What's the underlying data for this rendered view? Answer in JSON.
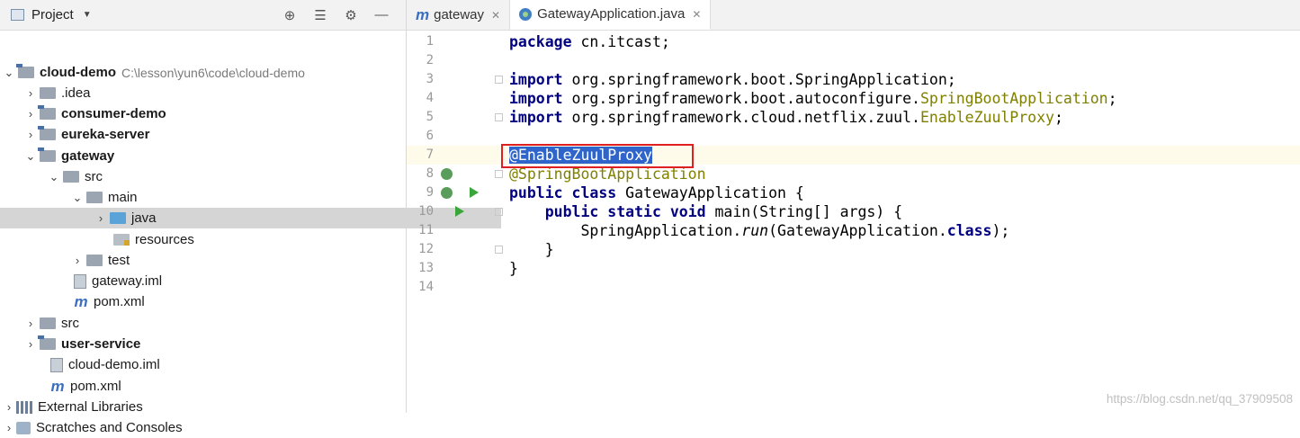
{
  "project_panel": {
    "title": "Project",
    "tools": [
      "target-icon",
      "collapse-icon",
      "gear-icon",
      "minimize-icon"
    ],
    "tree": [
      {
        "label": "cloud-demo",
        "path": "C:\\lesson\\yun6\\code\\cloud-demo"
      },
      {
        "label": ".idea"
      },
      {
        "label": "consumer-demo"
      },
      {
        "label": "eureka-server"
      },
      {
        "label": "gateway"
      },
      {
        "label": "src"
      },
      {
        "label": "main"
      },
      {
        "label": "java"
      },
      {
        "label": "resources"
      },
      {
        "label": "test"
      },
      {
        "label": "gateway.iml"
      },
      {
        "label": "pom.xml"
      },
      {
        "label": "src"
      },
      {
        "label": "user-service"
      },
      {
        "label": "cloud-demo.iml"
      },
      {
        "label": "pom.xml"
      },
      {
        "label": "External Libraries"
      },
      {
        "label": "Scratches and Consoles"
      }
    ]
  },
  "editor": {
    "tabs": [
      {
        "label": "gateway",
        "close": "✕"
      },
      {
        "label": "GatewayApplication.java",
        "close": "✕"
      }
    ],
    "line_numbers": [
      "1",
      "2",
      "3",
      "4",
      "5",
      "6",
      "7",
      "8",
      "9",
      "10",
      "11",
      "12",
      "13",
      "14"
    ],
    "code": {
      "l1_kw": "package",
      "l1_rest": " cn.itcast;",
      "l3_kw": "import",
      "l3_rest": " org.springframework.boot.SpringApplication;",
      "l4_kw": "import",
      "l4_rest": " org.springframework.boot.autoconfigure.",
      "l4_ann": "SpringBootApplication",
      "l4_end": ";",
      "l5_kw": "import",
      "l5_rest": " org.springframework.cloud.netflix.zuul.",
      "l5_ann": "EnableZuulProxy",
      "l5_end": ";",
      "l7_sel": "@EnableZuulProxy",
      "l8_ann": "@SpringBootApplication",
      "l9_kw": "public class",
      "l9_rest": " GatewayApplication {",
      "l10_indent": "    ",
      "l10_kw": "public static void",
      "l10_rest": " main(String[] args) {",
      "l11_pre": "        SpringApplication.",
      "l11_it": "run",
      "l11_mid": "(GatewayApplication.",
      "l11_kw": "class",
      "l11_end": ");",
      "l12": "    }",
      "l13": "}"
    }
  },
  "watermark": "https://blog.csdn.net/qq_37909508"
}
